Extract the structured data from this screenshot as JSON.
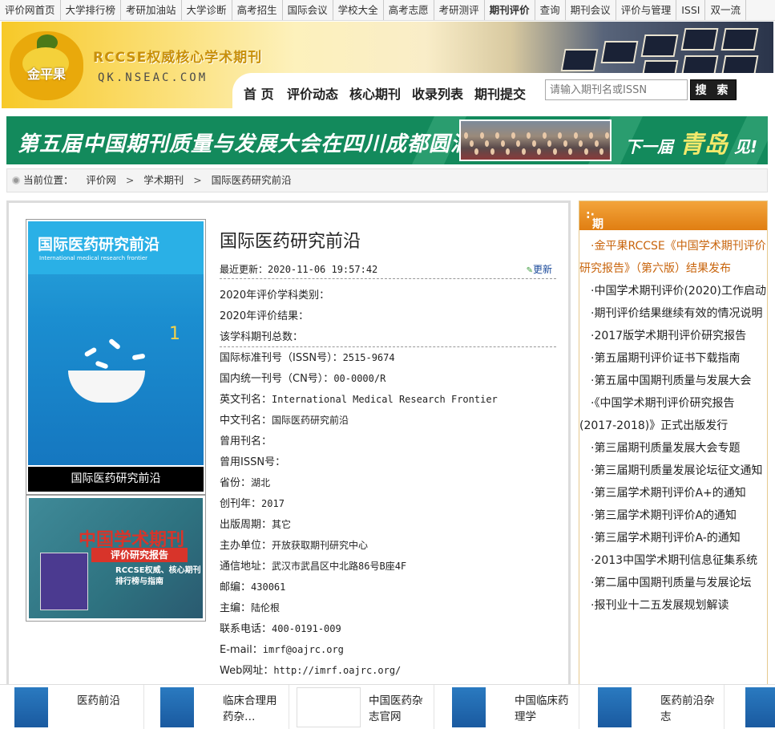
{
  "topnav": [
    "评价网首页",
    "大学排行榜",
    "考研加油站",
    "大学诊断",
    "高考招生",
    "国际会议",
    "学校大全",
    "高考志愿",
    "考研测评",
    "期刊评价",
    "查询",
    "期刊会议",
    "评价与管理",
    "ISSI",
    "双一流"
  ],
  "header": {
    "logo_text": "金平果",
    "site_title": "RCCSE权威核心学术期刊",
    "site_domain": "QK.NSEAC.COM",
    "nav": [
      "首 页",
      "评价动态",
      "核心期刊",
      "收录列表",
      "期刊提交"
    ],
    "search_placeholder": "请输入期刊名或ISSN",
    "search_button": "搜 索"
  },
  "banner": {
    "text": "第五届中国期刊质量与发展大会在四川成都圆满召开!",
    "next_prefix": "下一届",
    "next_city": "青岛",
    "next_suffix": "见!"
  },
  "breadcrumb": {
    "label": "当前位置：",
    "items": [
      "评价网",
      "学术期刊",
      "国际医药研究前沿"
    ],
    "sep": ">"
  },
  "journal": {
    "cover": {
      "title_cn": "国际医药研究前沿",
      "title_en": "International medical research frontier",
      "issue_num": "1",
      "caption": "国际医药研究前沿"
    },
    "ad": {
      "title": "中国学术期刊",
      "subtitle": "评价研究报告",
      "line1": "RCCSE权威、核心期刊",
      "line2": "排行榜与指南"
    },
    "title": "国际医药研究前沿",
    "updated_label": "最近更新：",
    "updated_value": "2020-11-06 19:57:42",
    "update_link": "更新",
    "fields": [
      {
        "label": "2020年评价学科类别：",
        "value": ""
      },
      {
        "label": "2020年评价结果：",
        "value": ""
      },
      {
        "label": "该学科期刊总数：",
        "value": ""
      },
      {
        "label": "国际标准刊号（ISSN号）：",
        "value": "2515-9674"
      },
      {
        "label": "国内统一刊号（CN号）：",
        "value": "00-0000/R"
      },
      {
        "label": "英文刊名：",
        "value": "International Medical Research Frontier"
      },
      {
        "label": "中文刊名：",
        "value": "国际医药研究前沿"
      },
      {
        "label": "曾用刊名：",
        "value": ""
      },
      {
        "label": "曾用ISSN号：",
        "value": ""
      },
      {
        "label": "省份：",
        "value": "湖北"
      },
      {
        "label": "创刊年：",
        "value": "2017"
      },
      {
        "label": "出版周期：",
        "value": "其它"
      },
      {
        "label": "主办单位：",
        "value": "开放获取期刊研究中心"
      },
      {
        "label": "通信地址：",
        "value": "武汉市武昌区中北路86号B座4F"
      },
      {
        "label": "邮编：",
        "value": "430061"
      },
      {
        "label": "主编：",
        "value": "陆伦根"
      },
      {
        "label": "联系电话：",
        "value": "400-0191-009"
      },
      {
        "label": "E-mail：",
        "value": "imrf@oajrc.org"
      },
      {
        "label": "Web网址：",
        "value": "http://imrf.oajrc.org/"
      }
    ]
  },
  "sidebar": {
    "title": "期刊评价动态",
    "news": [
      "·金平果RCCSE《中国学术期刊评价研究报告》（第六版）结果发布",
      "·中国学术期刊评价(2020)工作启动",
      "·期刊评价结果继续有效的情况说明",
      "·2017版学术期刊评价研究报告",
      "·第五届期刊评价证书下载指南",
      "·第五届中国期刊质量与发展大会",
      "·《中国学术期刊评价研究报告(2017-2018)》正式出版发行",
      "·第三届期刊质量发展大会专题",
      "·第三届期刊质量发展论坛征文通知",
      "·第三届学术期刊评价A+的通知",
      "·第三届学术期刊评价A的通知",
      "·第三届学术期刊评价A-的通知",
      "·2013中国学术期刊信息征集系统",
      "·第二届中国期刊质量与发展论坛",
      "·报刊业十二五发展规划解读"
    ]
  },
  "bottom": [
    "医药前沿",
    "临床合理用药杂…",
    "中国医药杂志官网",
    "中国临床药理学",
    "医药前沿杂志"
  ],
  "colors": {
    "accent": "#e07e12",
    "banner": "#138a5c",
    "news_highlight": "#c8640c"
  }
}
